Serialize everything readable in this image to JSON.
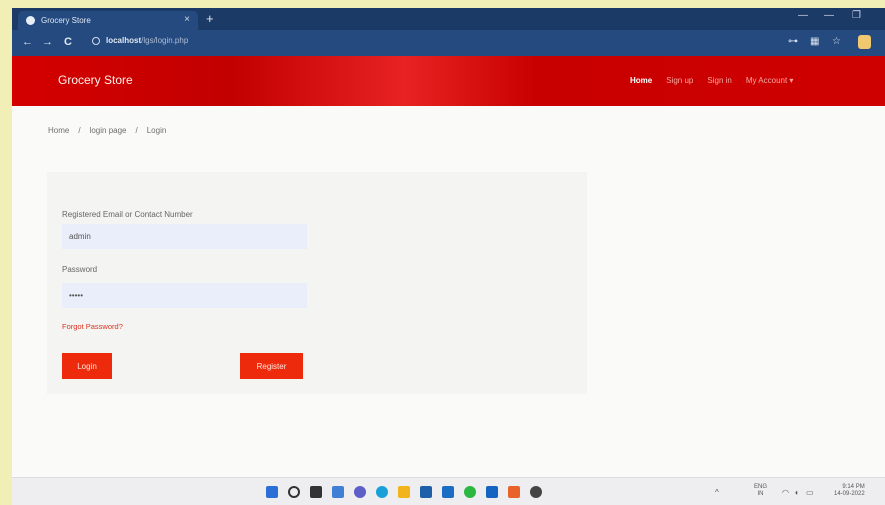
{
  "browser": {
    "tab_title": "Grocery Store",
    "tab_close": "×",
    "new_tab": "+",
    "url_host": "localhost",
    "url_path": "/lgs/login.php",
    "back": "←",
    "forward": "→",
    "reload": "C"
  },
  "navbar": {
    "brand": "Grocery Store",
    "links": [
      "Home",
      "Sign up",
      "Sign in",
      "My Account ▾"
    ]
  },
  "breadcrumb": [
    "Home",
    "/",
    "login page",
    "/",
    "Login"
  ],
  "form": {
    "email_label": "Registered Email or Contact Number",
    "email_value": "admin",
    "password_label": "Password",
    "password_value": "•••••",
    "forgot_link": "Forgot Password?",
    "login_button": "Login",
    "register_button": "Register"
  },
  "taskbar": {
    "lang_top": "ENG",
    "lang_bottom": "IN",
    "time": "9:14 PM",
    "date": "14-09-2022"
  },
  "colors": {
    "navbar_red": "#d40000",
    "button_red": "#ee2a0d",
    "browser_blue": "#244a7f",
    "input_bg": "#eaeefb"
  }
}
